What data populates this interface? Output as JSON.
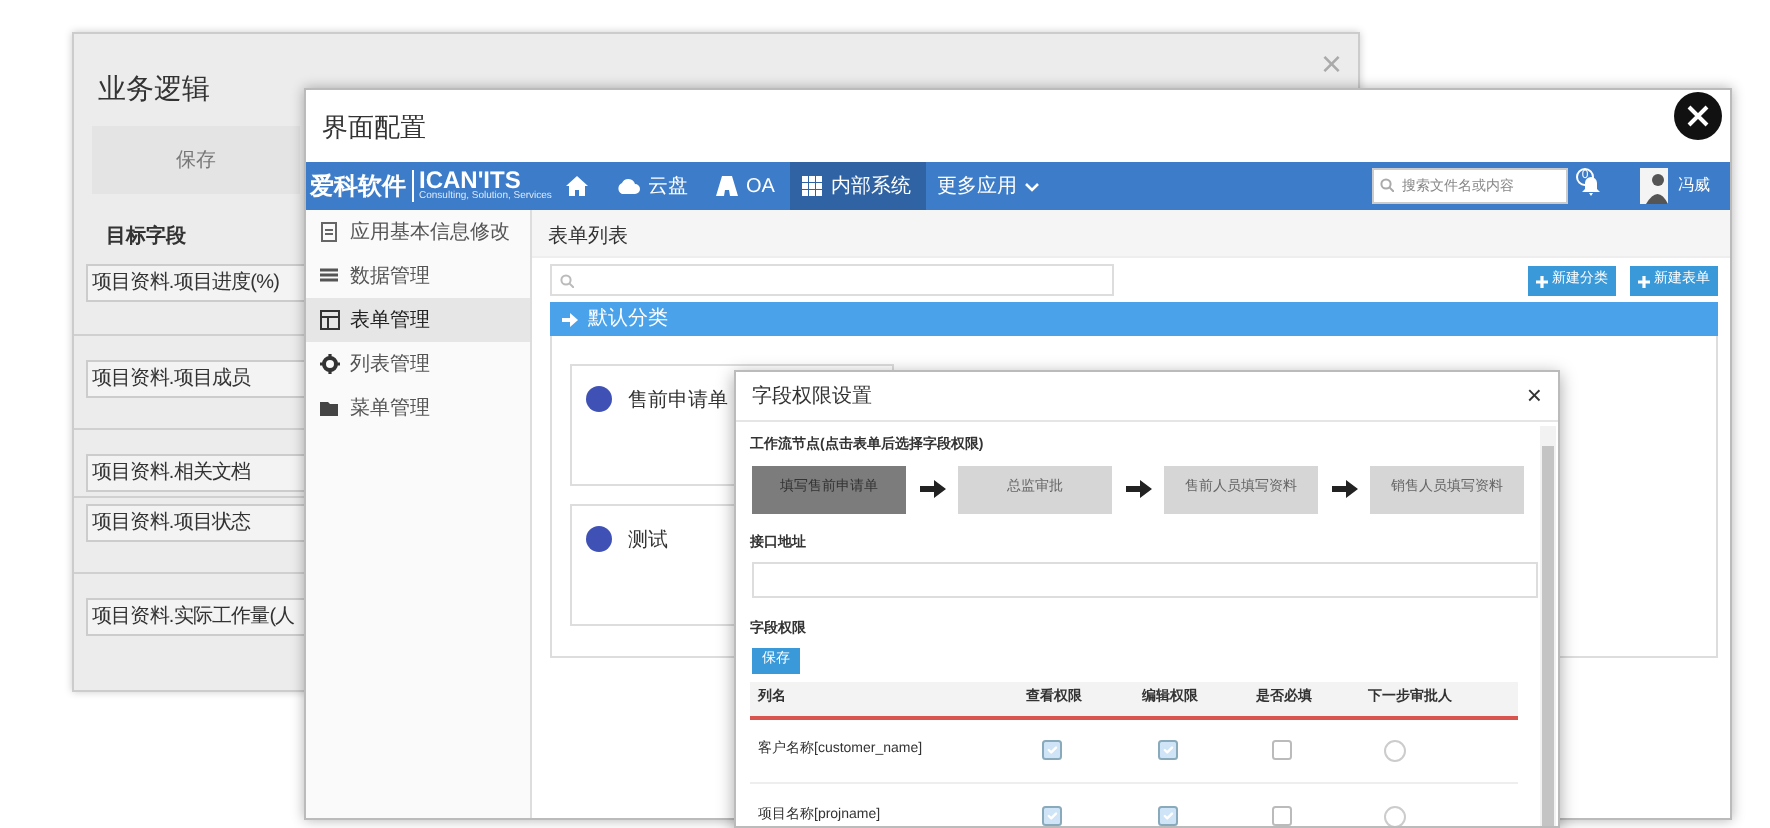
{
  "back_window": {
    "title": "业务逻辑",
    "close": "×",
    "save_button": "保存",
    "section_label": "目标字段",
    "fields": [
      {
        "label": "项目资料.项目进度(%)"
      },
      {
        "label": "项目资料.项目成员"
      },
      {
        "label": "项目资料.相关文档"
      },
      {
        "label": "项目资料.项目状态"
      },
      {
        "label": "项目资料.实际工作量(人"
      }
    ]
  },
  "front_window": {
    "title": "界面配置",
    "navbar": {
      "brand": "爱科软件",
      "logo_text": "ICAN'ITS",
      "logo_tagline": "Consulting, Solution, Services",
      "items": [
        {
          "label": "云盘",
          "selected": false
        },
        {
          "label": "OA",
          "selected": false
        },
        {
          "label": "内部系统",
          "selected": true
        }
      ],
      "more_menu": "更多应用",
      "search_placeholder": "搜索文件名或内容",
      "notification_count": "0",
      "user_name": "冯威"
    },
    "sidebar": {
      "items": [
        {
          "label": "应用基本信息修改",
          "selected": false
        },
        {
          "label": "数据管理",
          "selected": false
        },
        {
          "label": "表单管理",
          "selected": true
        },
        {
          "label": "列表管理",
          "selected": false
        },
        {
          "label": "菜单管理",
          "selected": false
        }
      ]
    },
    "breadcrumb": "表单列表",
    "buttons": [
      {
        "label": "新建分类"
      },
      {
        "label": "新建表单"
      }
    ],
    "category": "默认分类",
    "forms": [
      {
        "title": "售前申请单"
      },
      {
        "title": "测试"
      }
    ]
  },
  "dialog": {
    "title": "字段权限设置",
    "close": "×",
    "workflow_label": "工作流节点(点击表单后选择字段权限)",
    "steps": [
      {
        "label": "填写售前申请单",
        "selected": true
      },
      {
        "label": "总监审批",
        "selected": false
      },
      {
        "label": "售前人员填写资料",
        "selected": false
      },
      {
        "label": "销售人员填写资料",
        "selected": false
      }
    ],
    "interface_label": "接口地址",
    "permissions_label": "字段权限",
    "save_button": "保存",
    "columns": [
      "列名",
      "查看权限",
      "编辑权限",
      "是否必填",
      "下一步审批人"
    ],
    "rows": [
      {
        "name": "客户名称[customer_name]",
        "view": true,
        "edit": true,
        "required": false,
        "approver_selected": false
      },
      {
        "name": "项目名称[projname]",
        "view": true,
        "edit": true,
        "required": false,
        "approver_selected": false
      }
    ]
  }
}
